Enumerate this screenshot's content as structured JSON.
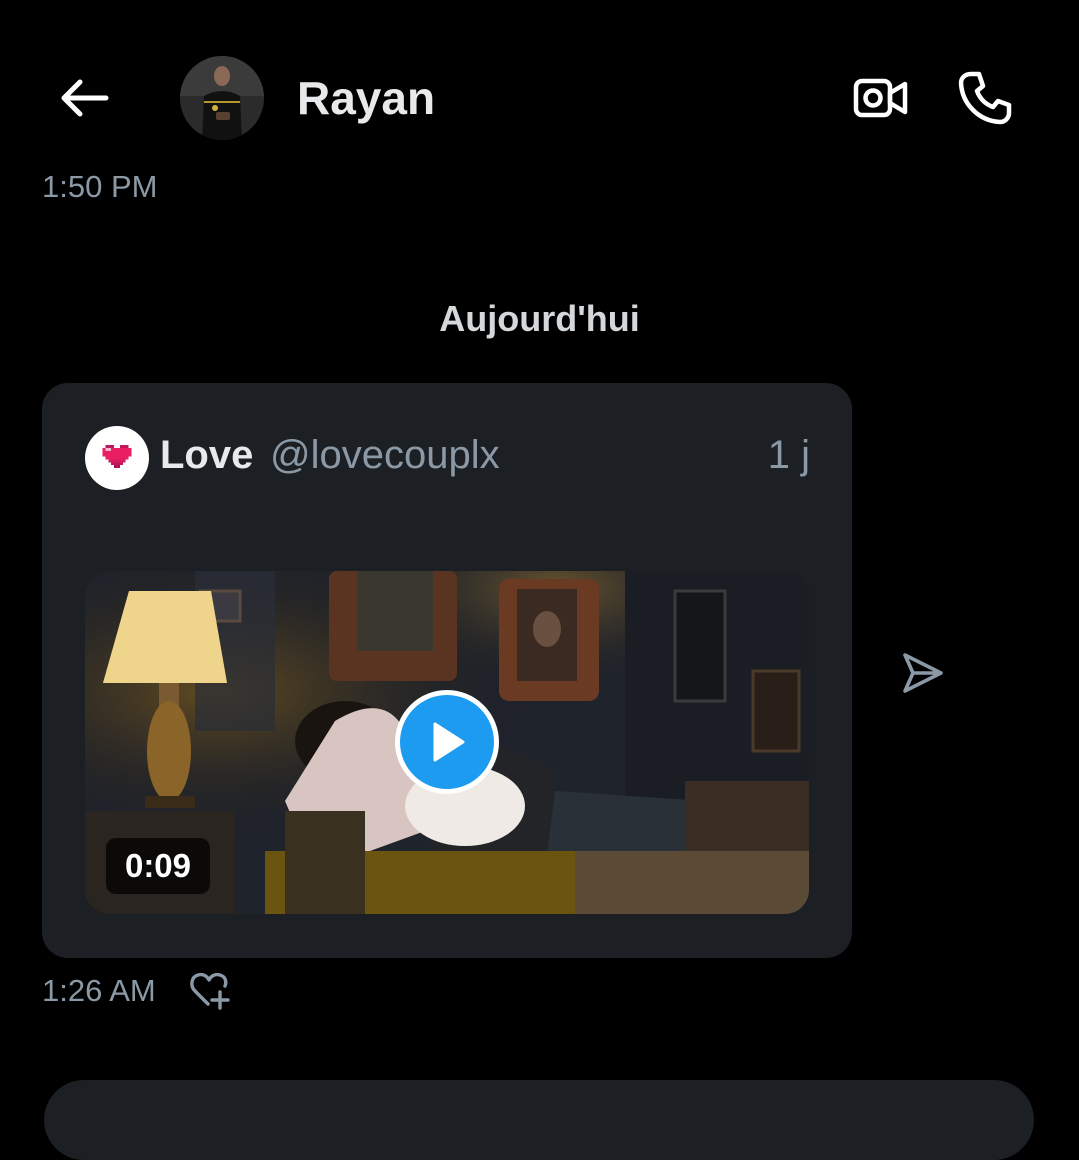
{
  "header": {
    "back_icon": "arrow-left-icon",
    "contact_name": "Rayan",
    "video_call_icon": "video-camera-icon",
    "voice_call_icon": "phone-icon"
  },
  "messages": {
    "previous_time": "1:50 PM",
    "date_separator": "Aujourd'hui"
  },
  "shared_post": {
    "author_icon": "pixel-heart-icon",
    "author_name": "Love",
    "author_handle": "@lovecouplx",
    "age": "1 j",
    "video": {
      "duration": "0:09",
      "play_icon": "play-icon"
    },
    "share_icon": "share-send-icon",
    "sent_time": "1:26 AM",
    "reaction_icon": "heart-plus-icon"
  },
  "colors": {
    "background": "#000000",
    "card": "#1c2024",
    "accent": "#1d9bf0",
    "muted_text": "#8b98a5"
  }
}
